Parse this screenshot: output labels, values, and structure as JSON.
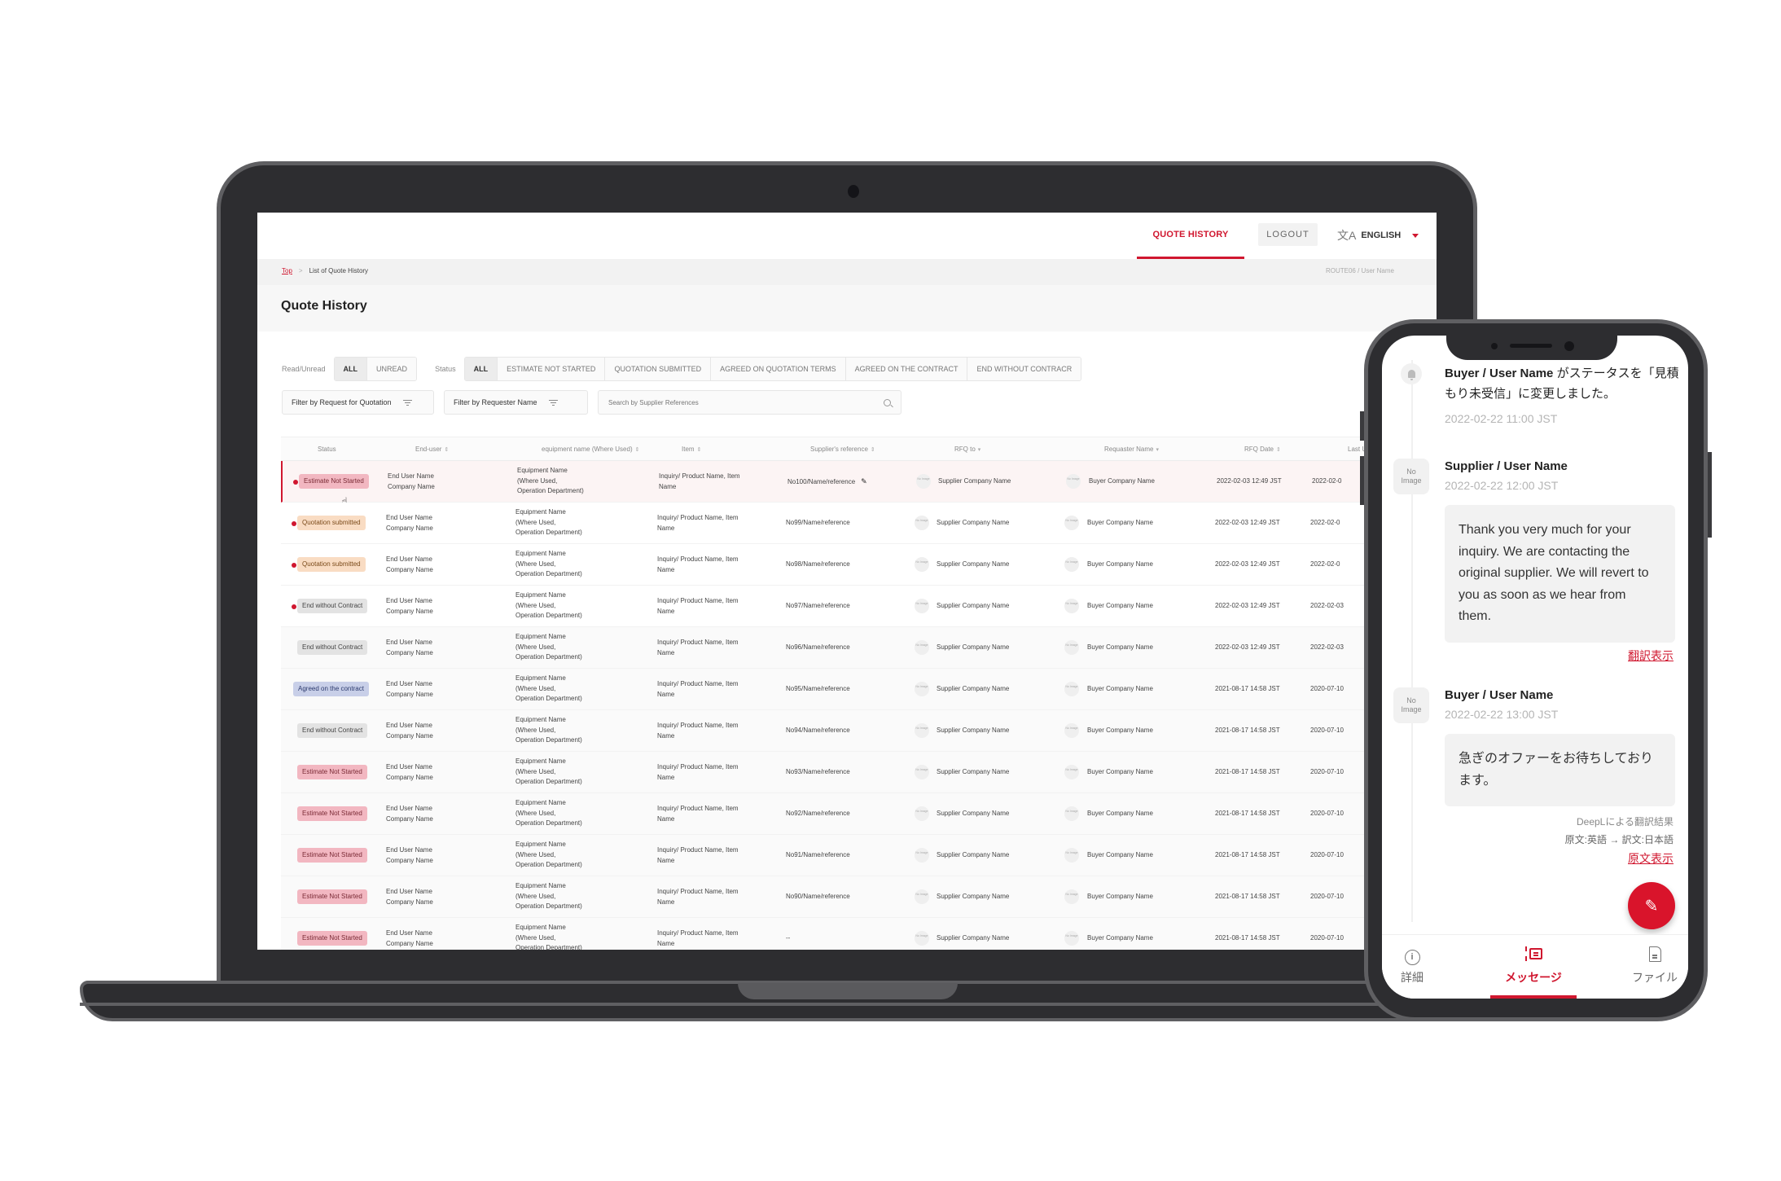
{
  "desktop": {
    "nav": {
      "quote_history": "QUOTE HISTORY",
      "logout": "LOGOUT",
      "language": "ENGLISH",
      "language_icon": "translate-icon"
    },
    "breadcrumb": {
      "top": "Top",
      "separator": ">",
      "current": "List of Quote History"
    },
    "user_label": "ROUTE06 / User Name",
    "page_title": "Quote History",
    "filters": {
      "read_label": "Read/Unread",
      "read_options": [
        "ALL",
        "UNREAD"
      ],
      "read_selected": "ALL",
      "status_label": "Status",
      "status_options": [
        "ALL",
        "ESTIMATE NOT STARTED",
        "QUOTATION SUBMITTED",
        "AGREED ON QUOTATION TERMS",
        "AGREED ON THE CONTRACT",
        "END WITHOUT CONTRACR"
      ],
      "status_selected": "ALL",
      "filter_rfq": "Filter by Request for Quotation",
      "filter_requester": "Filter by Requester Name",
      "search_placeholder": "Search by Supplier References"
    },
    "table": {
      "columns": [
        {
          "label": "Status",
          "sort": ""
        },
        {
          "label": "End-user",
          "sort": "⇕"
        },
        {
          "label": "equipment name (Where Used)",
          "sort": "⇕"
        },
        {
          "label": "Item",
          "sort": "⇕"
        },
        {
          "label": "Supplier's reference",
          "sort": "⇕"
        },
        {
          "label": "RFQ to",
          "sort": "▾"
        },
        {
          "label": "Requaster Name",
          "sort": "▾"
        },
        {
          "label": "RFQ Date",
          "sort": "⇕"
        },
        {
          "label": "Last Upd",
          "sort": ""
        }
      ],
      "rows": [
        {
          "status": "Estimate Not Started",
          "kind": "estimate",
          "unread": true,
          "highlight": true,
          "end_user": [
            "End User Name",
            "Company Name"
          ],
          "equipment": [
            "Equipment Name",
            "(Where Used,",
            "Operation Department)"
          ],
          "item": [
            "Inquiry/ Product Name, Item",
            "Name"
          ],
          "ref": "No100/Name/reference",
          "editable": true,
          "rfq_to": "Supplier Company Name",
          "requester": "Buyer Company Name",
          "rfq_date": "2022-02-03 12:49 JST",
          "last_update": "2022-02-0"
        },
        {
          "status": "Quotation submitted",
          "kind": "quotation",
          "unread": true,
          "highlight": false,
          "end_user": [
            "End User Name",
            "Company Name"
          ],
          "equipment": [
            "Equipment Name",
            "(Where Used,",
            "Operation Department)"
          ],
          "item": [
            "Inquiry/ Product Name, Item",
            "Name"
          ],
          "ref": "No99/Name/reference",
          "editable": false,
          "rfq_to": "Supplier Company Name",
          "requester": "Buyer Company Name",
          "rfq_date": "2022-02-03 12:49 JST",
          "last_update": "2022-02-0"
        },
        {
          "status": "Quotation submitted",
          "kind": "quotation",
          "unread": true,
          "highlight": false,
          "end_user": [
            "End User Name",
            "Company Name"
          ],
          "equipment": [
            "Equipment Name",
            "(Where Used,",
            "Operation Department)"
          ],
          "item": [
            "Inquiry/ Product Name, Item",
            "Name"
          ],
          "ref": "No98/Name/reference",
          "editable": false,
          "rfq_to": "Supplier Company Name",
          "requester": "Buyer Company Name",
          "rfq_date": "2022-02-03 12:49 JST",
          "last_update": "2022-02-0"
        },
        {
          "status": "End without Contract",
          "kind": "end",
          "unread": true,
          "highlight": false,
          "end_user": [
            "End User Name",
            "Company Name"
          ],
          "equipment": [
            "Equipment Name",
            "(Where Used,",
            "Operation Department)"
          ],
          "item": [
            "Inquiry/ Product Name, Item",
            "Name"
          ],
          "ref": "No97/Name/reference",
          "editable": false,
          "rfq_to": "Supplier Company Name",
          "requester": "Buyer Company Name",
          "rfq_date": "2022-02-03 12:49 JST",
          "last_update": "2022-02-03"
        },
        {
          "status": "End without Contract",
          "kind": "end",
          "unread": false,
          "highlight": false,
          "end_user": [
            "End User Name",
            "Company Name"
          ],
          "equipment": [
            "Equipment Name",
            "(Where Used,",
            "Operation Department)"
          ],
          "item": [
            "Inquiry/ Product Name, Item",
            "Name"
          ],
          "ref": "No96/Name/reference",
          "editable": false,
          "rfq_to": "Supplier Company Name",
          "requester": "Buyer Company Name",
          "rfq_date": "2022-02-03 12:49 JST",
          "last_update": "2022-02-03"
        },
        {
          "status": "Agreed on the contract",
          "kind": "agreed",
          "unread": false,
          "highlight": false,
          "end_user": [
            "End User Name",
            "Company Name"
          ],
          "equipment": [
            "Equipment Name",
            "(Where Used,",
            "Operation Department)"
          ],
          "item": [
            "Inquiry/ Product Name, Item",
            "Name"
          ],
          "ref": "No95/Name/reference",
          "editable": false,
          "rfq_to": "Supplier Company Name",
          "requester": "Buyer Company Name",
          "rfq_date": "2021-08-17 14:58 JST",
          "last_update": "2020-07-10"
        },
        {
          "status": "End without Contract",
          "kind": "end",
          "unread": false,
          "highlight": false,
          "end_user": [
            "End User Name",
            "Company Name"
          ],
          "equipment": [
            "Equipment Name",
            "(Where Used,",
            "Operation Department)"
          ],
          "item": [
            "Inquiry/ Product Name, Item",
            "Name"
          ],
          "ref": "No94/Name/reference",
          "editable": false,
          "rfq_to": "Supplier Company Name",
          "requester": "Buyer Company Name",
          "rfq_date": "2021-08-17 14:58 JST",
          "last_update": "2020-07-10"
        },
        {
          "status": "Estimate Not Started",
          "kind": "estimate",
          "unread": false,
          "highlight": false,
          "end_user": [
            "End User Name",
            "Company Name"
          ],
          "equipment": [
            "Equipment Name",
            "(Where Used,",
            "Operation Department)"
          ],
          "item": [
            "Inquiry/ Product Name, Item",
            "Name"
          ],
          "ref": "No93/Name/reference",
          "editable": false,
          "rfq_to": "Supplier Company Name",
          "requester": "Buyer Company Name",
          "rfq_date": "2021-08-17 14:58 JST",
          "last_update": "2020-07-10"
        },
        {
          "status": "Estimate Not Started",
          "kind": "estimate",
          "unread": false,
          "highlight": false,
          "end_user": [
            "End User Name",
            "Company Name"
          ],
          "equipment": [
            "Equipment Name",
            "(Where Used,",
            "Operation Department)"
          ],
          "item": [
            "Inquiry/ Product Name, Item",
            "Name"
          ],
          "ref": "No92/Name/reference",
          "editable": false,
          "rfq_to": "Supplier Company Name",
          "requester": "Buyer Company Name",
          "rfq_date": "2021-08-17 14:58 JST",
          "last_update": "2020-07-10"
        },
        {
          "status": "Estimate Not Started",
          "kind": "estimate",
          "unread": false,
          "highlight": false,
          "end_user": [
            "End User Name",
            "Company Name"
          ],
          "equipment": [
            "Equipment Name",
            "(Where Used,",
            "Operation Department)"
          ],
          "item": [
            "Inquiry/ Product Name, Item",
            "Name"
          ],
          "ref": "No91/Name/reference",
          "editable": false,
          "rfq_to": "Supplier Company Name",
          "requester": "Buyer Company Name",
          "rfq_date": "2021-08-17 14:58 JST",
          "last_update": "2020-07-10"
        },
        {
          "status": "Estimate Not Started",
          "kind": "estimate",
          "unread": false,
          "highlight": false,
          "end_user": [
            "End User Name",
            "Company Name"
          ],
          "equipment": [
            "Equipment Name",
            "(Where Used,",
            "Operation Department)"
          ],
          "item": [
            "Inquiry/ Product Name, Item",
            "Name"
          ],
          "ref": "No90/Name/reference",
          "editable": false,
          "rfq_to": "Supplier Company Name",
          "requester": "Buyer Company Name",
          "rfq_date": "2021-08-17 14:58 JST",
          "last_update": "2020-07-10"
        },
        {
          "status": "Estimate Not Started",
          "kind": "estimate",
          "unread": false,
          "highlight": false,
          "end_user": [
            "End User Name",
            "Company Name"
          ],
          "equipment": [
            "Equipment Name",
            "(Where Used,",
            "Operation Department)"
          ],
          "item": [
            "Inquiry/ Product Name, Item",
            "Name"
          ],
          "ref": "--",
          "editable": false,
          "rfq_to": "Supplier Company Name",
          "requester": "Buyer Company Name",
          "rfq_date": "2021-08-17 14:58 JST",
          "last_update": "2020-07-10"
        }
      ],
      "no_image_label": "No Image"
    }
  },
  "mobile": {
    "system_message": {
      "actor": "Buyer / User Name",
      "text_after": " がステータスを「見積もり未受信」に変更しました。",
      "time": "2022-02-22 11:00 JST"
    },
    "messages": [
      {
        "sender": "Supplier / User Name",
        "time": "2022-02-22 12:00 JST",
        "avatar": "No Image",
        "body": "Thank you very much for your inquiry. We are contacting the original supplier. We will revert to you as soon as we hear from them.",
        "link": "翻訳表示"
      },
      {
        "sender": "Buyer / User Name",
        "time": "2022-02-22 13:00 JST",
        "avatar": "No Image",
        "body": "急ぎのオファーをお待ちしております。",
        "note1": "DeepLによる翻訳結果",
        "note2": "原文:英語 → 訳文:日本語",
        "link": "原文表示"
      }
    ],
    "fab_icon": "pencil-icon",
    "bottom_nav": [
      {
        "label": "詳細",
        "icon": "info-icon",
        "active": false
      },
      {
        "label": "メッセージ",
        "icon": "message-icon",
        "active": true
      },
      {
        "label": "ファイル",
        "icon": "file-icon",
        "active": false
      }
    ]
  },
  "colors": {
    "accent": "#d0172f",
    "estimate_badge": "#f2b7c1",
    "quotation_badge": "#f9dcc3",
    "end_badge": "#e3e3e3",
    "agreed_badge": "#c8cfe8"
  }
}
